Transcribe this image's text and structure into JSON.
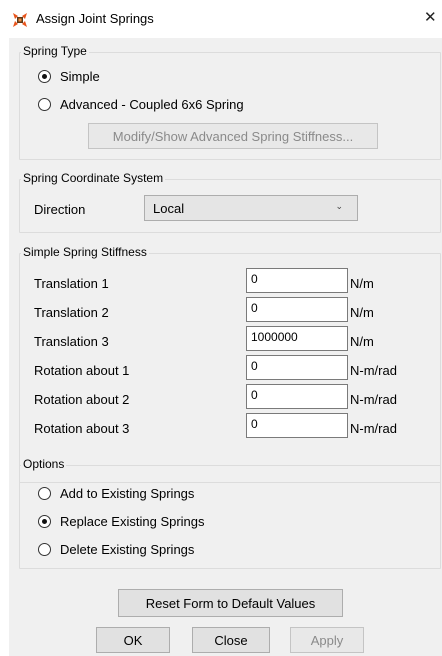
{
  "window": {
    "title": "Assign Joint Springs",
    "close_glyph": "✕"
  },
  "spring_type": {
    "legend": "Spring Type",
    "options": [
      {
        "label": "Simple",
        "checked": true
      },
      {
        "label": "Advanced - Coupled 6x6 Spring",
        "checked": false
      }
    ],
    "advanced_button": "Modify/Show Advanced Spring Stiffness..."
  },
  "coordinate_system": {
    "legend": "Spring Coordinate System",
    "direction_label": "Direction",
    "direction_value": "Local"
  },
  "stiffness": {
    "legend": "Simple Spring Stiffness",
    "rows": [
      {
        "label": "Translation 1",
        "value": "0",
        "unit": "N/m"
      },
      {
        "label": "Translation 2",
        "value": "0",
        "unit": "N/m"
      },
      {
        "label": "Translation 3",
        "value": "1000000",
        "unit": "N/m"
      },
      {
        "label": "Rotation about 1",
        "value": "0",
        "unit": "N-m/rad"
      },
      {
        "label": "Rotation about 2",
        "value": "0",
        "unit": "N-m/rad"
      },
      {
        "label": "Rotation about 3",
        "value": "0",
        "unit": "N-m/rad"
      }
    ]
  },
  "options": {
    "legend": "Options",
    "items": [
      {
        "label": "Add to Existing Springs",
        "checked": false
      },
      {
        "label": "Replace Existing Springs",
        "checked": true
      },
      {
        "label": "Delete Existing Springs",
        "checked": false
      }
    ]
  },
  "buttons": {
    "reset": "Reset Form to Default Values",
    "ok": "OK",
    "close": "Close",
    "apply": "Apply"
  },
  "icons": {
    "app": "spring-app-icon",
    "close": "close-icon",
    "dropdown": "chevron-down-icon"
  },
  "colors": {
    "app_icon_orange": "#e8541b",
    "app_icon_dark": "#5a3a1a"
  }
}
